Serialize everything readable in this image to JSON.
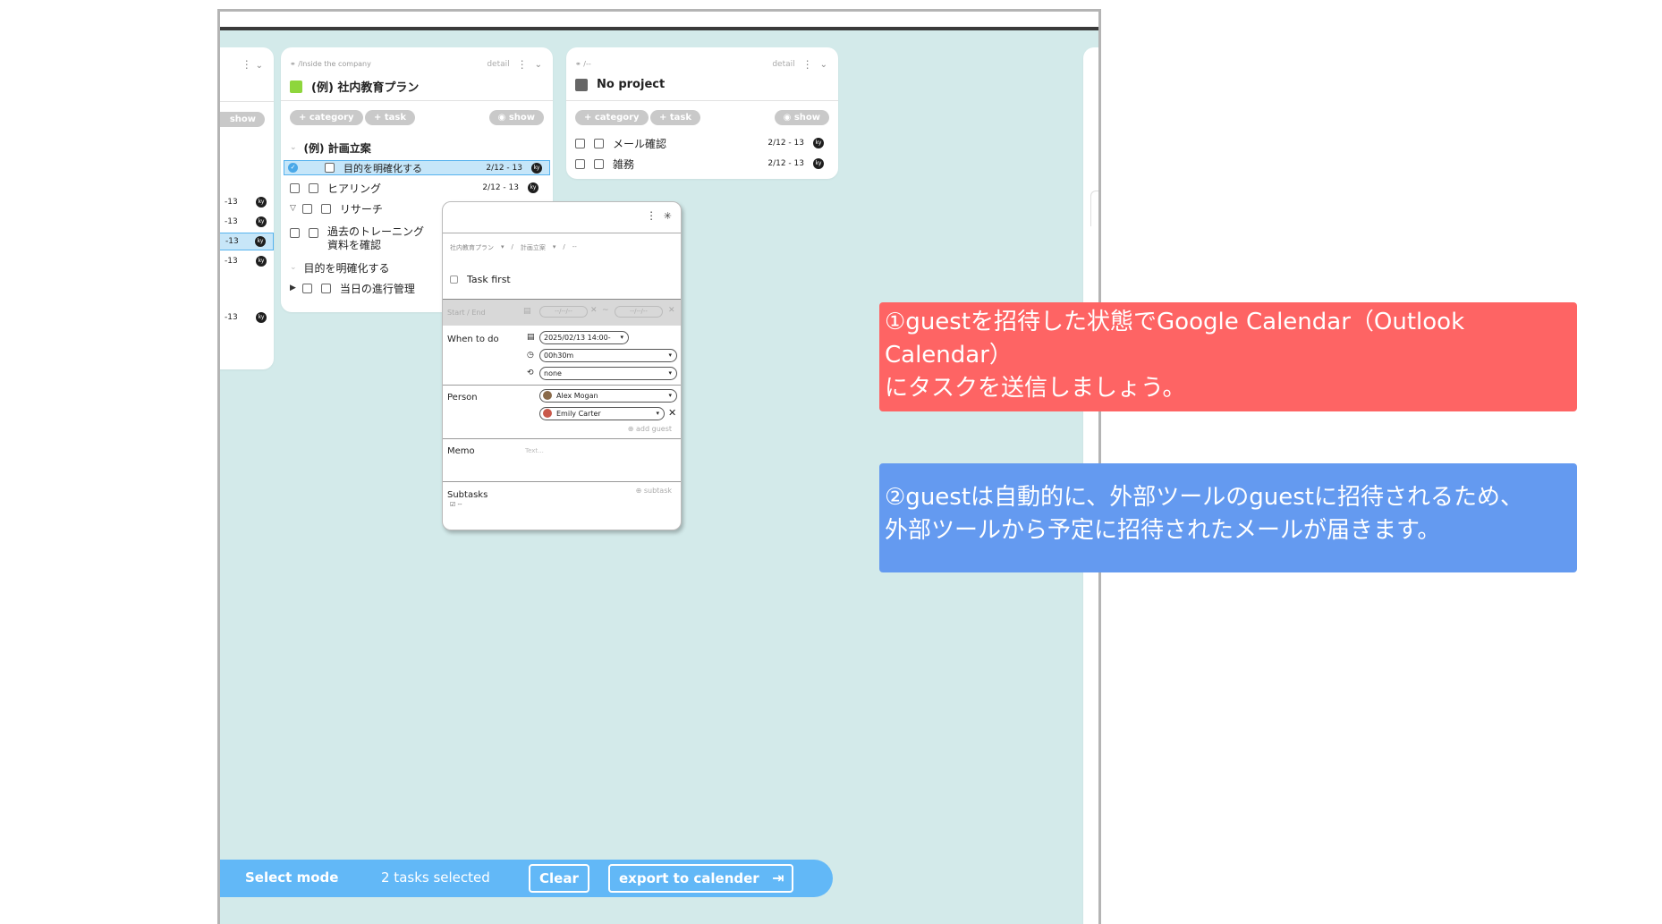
{
  "left_card": {
    "show_label": "show",
    "dates": [
      "-13",
      "-13",
      "-13",
      "-13",
      "-13"
    ]
  },
  "project_card": {
    "path": "/Inside the company",
    "detail": "detail",
    "color": "#8ed63c",
    "title": "(例) 社内教育プラン",
    "pills": {
      "category": "+ category",
      "task": "+ task",
      "show": "show"
    },
    "section": "(例) 計画立案",
    "tasks": [
      {
        "label": "目的を明確化する",
        "date": "2/12 - 13",
        "avatar": "ky",
        "selected": true
      },
      {
        "label": "ヒアリング",
        "date": "2/12 - 13",
        "avatar": "ky"
      },
      {
        "label": "リサーチ"
      },
      {
        "label": "過去のトレーニング",
        "label2": "資料を確認"
      },
      {
        "label": "目的を明確化する"
      },
      {
        "label": "当日の進行管理"
      }
    ]
  },
  "no_project_card": {
    "path": "/--",
    "detail": "detail",
    "color": "#666666",
    "title": "No project",
    "pills": {
      "category": "+ category",
      "task": "+ task",
      "show": "show"
    },
    "tasks": [
      {
        "label": "メール確認",
        "date": "2/12 - 13",
        "avatar": "ky"
      },
      {
        "label": "雑務",
        "date": "2/12 - 13",
        "avatar": "ky"
      }
    ]
  },
  "popup": {
    "breadcrumb": [
      "社内教育プラン",
      "/",
      "計画立案",
      "/",
      "--"
    ],
    "task_title": "Task first",
    "start_end_label": "Start / End",
    "start_placeholder": "--/--/--",
    "end_placeholder": "--/--/--",
    "when_label": "When to do",
    "when_date": "2025/02/13   14:00-",
    "duration": "00h30m",
    "repeat": "none",
    "person_label": "Person",
    "persons": [
      "Alex Mogan",
      "Emily Carter"
    ],
    "add_guest": "add guest",
    "memo_label": "Memo",
    "memo_placeholder": "Text...",
    "subtasks_label": "Subtasks",
    "subtask_add": "subtask",
    "subtask_item": "--"
  },
  "select_bar": {
    "mode": "Select mode",
    "count": "2 tasks selected",
    "clear": "Clear",
    "export": "export to calender"
  },
  "notes": {
    "note1_line1": "①guestを招待した状態でGoogle Calendar（Outlook",
    "note1_line2": "Calendar）",
    "note1_line3": "にタスクを送信しましょう。",
    "note1_color": "#fe6464",
    "note2_line1": "②guestは自動的に、外部ツールのguestに招待されるため、",
    "note2_line2": "外部ツールから予定に招待されたメールが届きます。",
    "note2_color": "#649af0"
  }
}
